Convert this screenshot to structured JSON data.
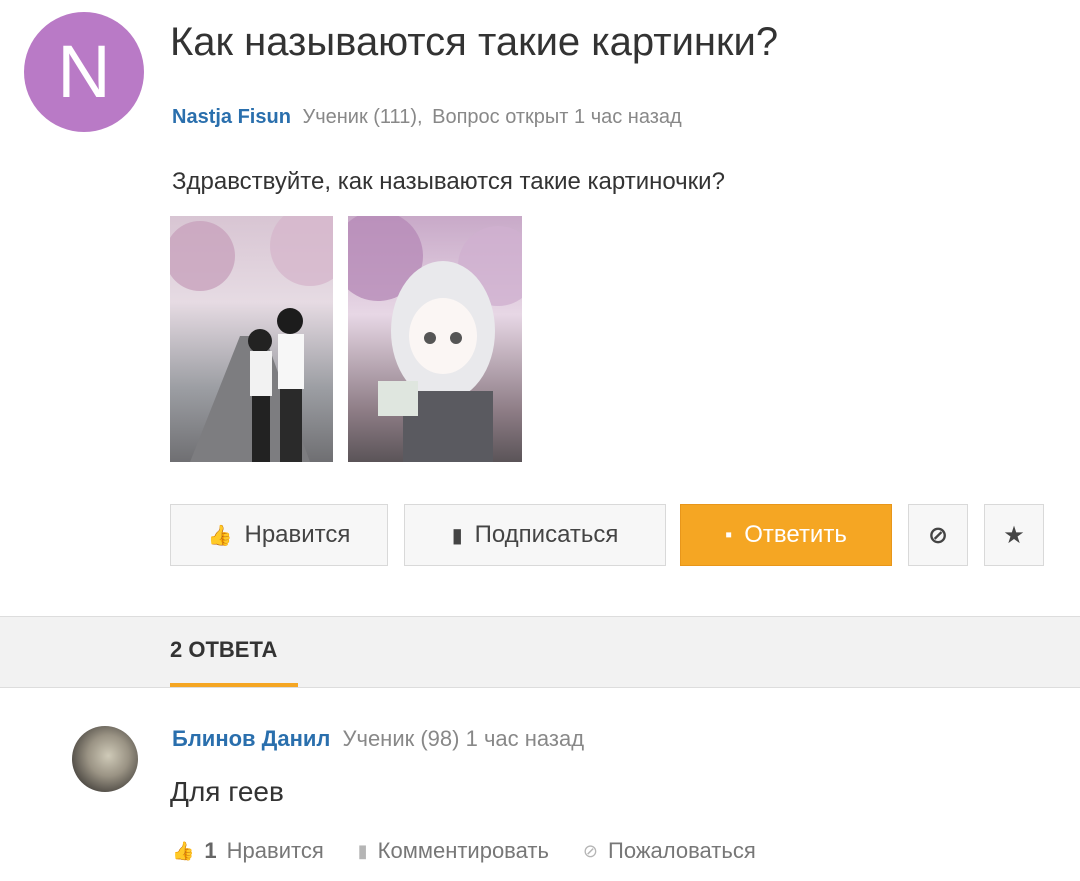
{
  "question": {
    "avatar_letter": "N",
    "title": "Как называются такие картинки?",
    "author": "Nastja Fisun",
    "author_rank": "Ученик (111),",
    "status": "Вопрос открыт 1 час назад",
    "body": "Здравствуйте, как называются такие картиночки?",
    "images": [
      "anime-couple-picture",
      "anime-girl-picture"
    ]
  },
  "actions": {
    "like_label": "Нравится",
    "subscribe_label": "Подписаться",
    "answer_label": "Ответить",
    "block_icon": "⊘",
    "star_icon": "★"
  },
  "answers_tab": {
    "label": "2 ОТВЕТА"
  },
  "answer": {
    "author": "Блинов Данил",
    "author_rank": "Ученик (98)",
    "time": "1 час назад",
    "body": "Для геев",
    "like_count": "1",
    "like_label": "Нравится",
    "comment_label": "Комментировать",
    "report_label": "Пожаловаться"
  },
  "colors": {
    "accent": "#f5a623",
    "author_link": "#2a6fad",
    "avatar_bg": "#b97ac6"
  }
}
